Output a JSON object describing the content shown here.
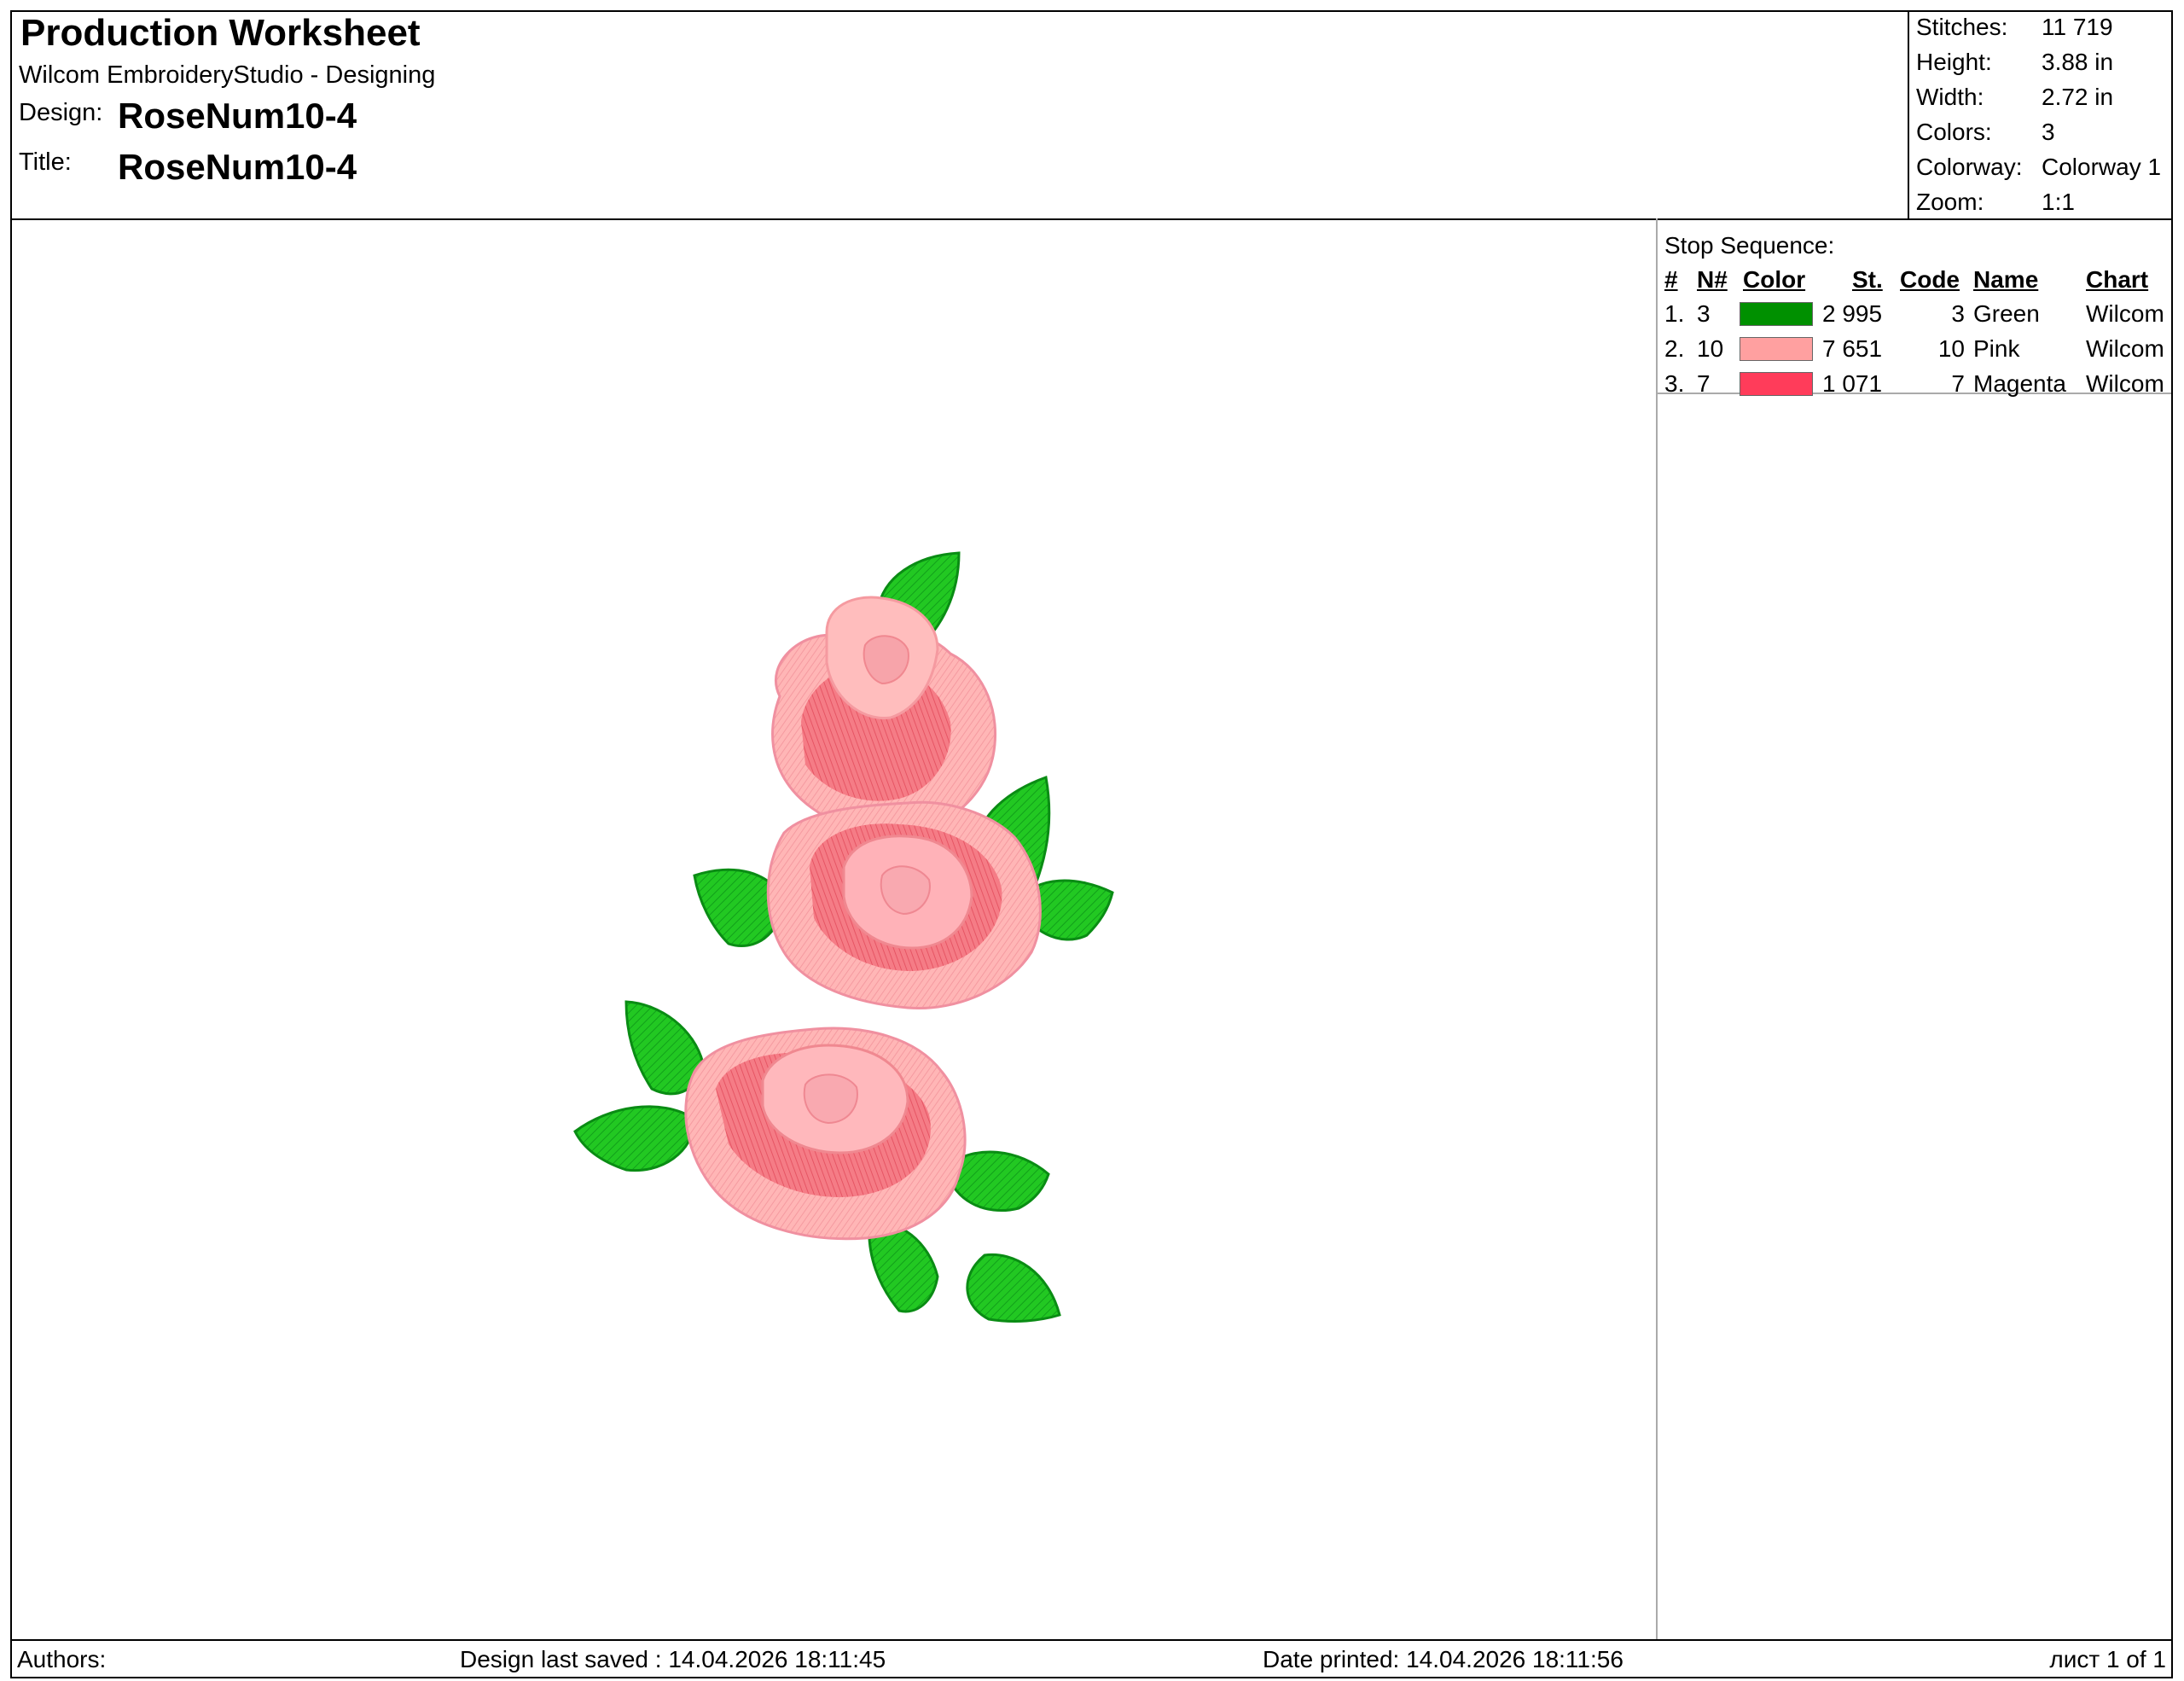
{
  "header": {
    "title": "Production Worksheet",
    "app": "Wilcom EmbroideryStudio - Designing",
    "design_label": "Design:",
    "design_value": "RoseNum10-4",
    "title_label": "Title:",
    "title_value": "RoseNum10-4"
  },
  "stats": [
    {
      "label": "Stitches:",
      "value": "11 719"
    },
    {
      "label": "Height:",
      "value": "3.88 in"
    },
    {
      "label": "Width:",
      "value": "2.72 in"
    },
    {
      "label": "Colors:",
      "value": "3"
    },
    {
      "label": "Colorway:",
      "value": "Colorway 1"
    },
    {
      "label": "Zoom:",
      "value": "1:1"
    }
  ],
  "stop_sequence": {
    "title": "Stop Sequence:",
    "headers": {
      "num": "#",
      "n": "N#",
      "color": "Color",
      "st": "St.",
      "code": "Code",
      "name": "Name",
      "chart": "Chart"
    },
    "rows": [
      {
        "num": "1.",
        "n": "3",
        "color": "#009000",
        "st": "2 995",
        "code": "3",
        "name": "Green",
        "chart": "Wilcom"
      },
      {
        "num": "2.",
        "n": "10",
        "color": "#ffa0a0",
        "st": "7 651",
        "code": "10",
        "name": "Pink",
        "chart": "Wilcom"
      },
      {
        "num": "3.",
        "n": "7",
        "color": "#ff3c5a",
        "st": "1 071",
        "code": "7",
        "name": "Magenta",
        "chart": "Wilcom"
      }
    ]
  },
  "footer": {
    "authors": "Authors:",
    "saved": "Design last saved : 14.04.2026 18:11:45",
    "printed": "Date printed: 14.04.2026 18:11:56",
    "page": "лист 1 of 1"
  },
  "colors": {
    "leaf": "#1ec81e",
    "leaf_dark": "#0a8c14",
    "petal_light": "#ffb4b4",
    "petal_mid": "#f57882",
    "petal_dark": "#e8505f"
  }
}
